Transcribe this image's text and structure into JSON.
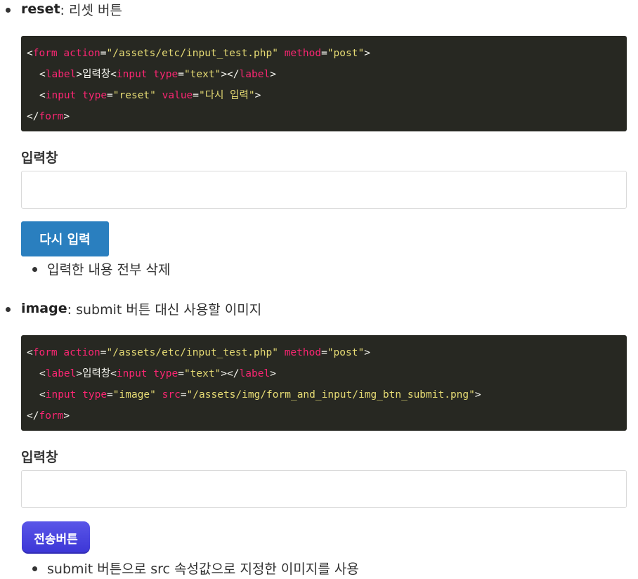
{
  "reset_section": {
    "keyword": "reset",
    "description": ": 리셋 버튼",
    "code_lines": [
      [
        [
          "punc",
          "<"
        ],
        [
          "tag",
          "form"
        ],
        [
          "text",
          " "
        ],
        [
          "attr",
          "action"
        ],
        [
          "punc",
          "="
        ],
        [
          "str",
          "\"/assets/etc/input_test.php\""
        ],
        [
          "text",
          " "
        ],
        [
          "attr",
          "method"
        ],
        [
          "punc",
          "="
        ],
        [
          "str",
          "\"post\""
        ],
        [
          "punc",
          ">"
        ]
      ],
      [
        [
          "punc",
          "<"
        ],
        [
          "tag",
          "label"
        ],
        [
          "punc",
          ">"
        ],
        [
          "text",
          "입력창"
        ],
        [
          "punc",
          "<"
        ],
        [
          "tag",
          "input"
        ],
        [
          "text",
          " "
        ],
        [
          "attr",
          "type"
        ],
        [
          "punc",
          "="
        ],
        [
          "str",
          "\"text\""
        ],
        [
          "punc",
          "></"
        ],
        [
          "tag",
          "label"
        ],
        [
          "punc",
          ">"
        ]
      ],
      [
        [
          "punc",
          "<"
        ],
        [
          "tag",
          "input"
        ],
        [
          "text",
          " "
        ],
        [
          "attr",
          "type"
        ],
        [
          "punc",
          "="
        ],
        [
          "str",
          "\"reset\""
        ],
        [
          "text",
          " "
        ],
        [
          "attr",
          "value"
        ],
        [
          "punc",
          "="
        ],
        [
          "str",
          "\"다시 입력\""
        ],
        [
          "punc",
          ">"
        ]
      ],
      [
        [
          "punc",
          "</"
        ],
        [
          "tag",
          "form"
        ],
        [
          "punc",
          ">"
        ]
      ]
    ],
    "field_label": "입력창",
    "input_value": "",
    "button_label": "다시 입력",
    "note": "입력한 내용 전부 삭제"
  },
  "image_section": {
    "keyword": "image",
    "description": ": submit 버튼 대신 사용할 이미지",
    "code_lines": [
      [
        [
          "punc",
          "<"
        ],
        [
          "tag",
          "form"
        ],
        [
          "text",
          " "
        ],
        [
          "attr",
          "action"
        ],
        [
          "punc",
          "="
        ],
        [
          "str",
          "\"/assets/etc/input_test.php\""
        ],
        [
          "text",
          " "
        ],
        [
          "attr",
          "method"
        ],
        [
          "punc",
          "="
        ],
        [
          "str",
          "\"post\""
        ],
        [
          "punc",
          ">"
        ]
      ],
      [
        [
          "punc",
          "<"
        ],
        [
          "tag",
          "label"
        ],
        [
          "punc",
          ">"
        ],
        [
          "text",
          "입력창"
        ],
        [
          "punc",
          "<"
        ],
        [
          "tag",
          "input"
        ],
        [
          "text",
          " "
        ],
        [
          "attr",
          "type"
        ],
        [
          "punc",
          "="
        ],
        [
          "str",
          "\"text\""
        ],
        [
          "punc",
          "></"
        ],
        [
          "tag",
          "label"
        ],
        [
          "punc",
          ">"
        ]
      ],
      [
        [
          "punc",
          "<"
        ],
        [
          "tag",
          "input"
        ],
        [
          "text",
          " "
        ],
        [
          "attr",
          "type"
        ],
        [
          "punc",
          "="
        ],
        [
          "str",
          "\"image\""
        ],
        [
          "text",
          " "
        ],
        [
          "attr",
          "src"
        ],
        [
          "punc",
          "="
        ],
        [
          "str",
          "\"/assets/img/form_and_input/img_btn_submit.png\""
        ],
        [
          "punc",
          ">"
        ]
      ],
      [
        [
          "punc",
          "</"
        ],
        [
          "tag",
          "form"
        ],
        [
          "punc",
          ">"
        ]
      ]
    ],
    "field_label": "입력창",
    "input_value": "",
    "button_label": "전송버튼",
    "note": "submit 버튼으로 src 속성값으로 지정한 이미지를 사용"
  },
  "colors": {
    "code_bg": "#272822",
    "code_tag": "#f92672",
    "code_string": "#e6db74",
    "code_text": "#f8f8f2",
    "reset_button_bg": "#2a7fbf",
    "image_button_bg": "#3b35d6"
  }
}
